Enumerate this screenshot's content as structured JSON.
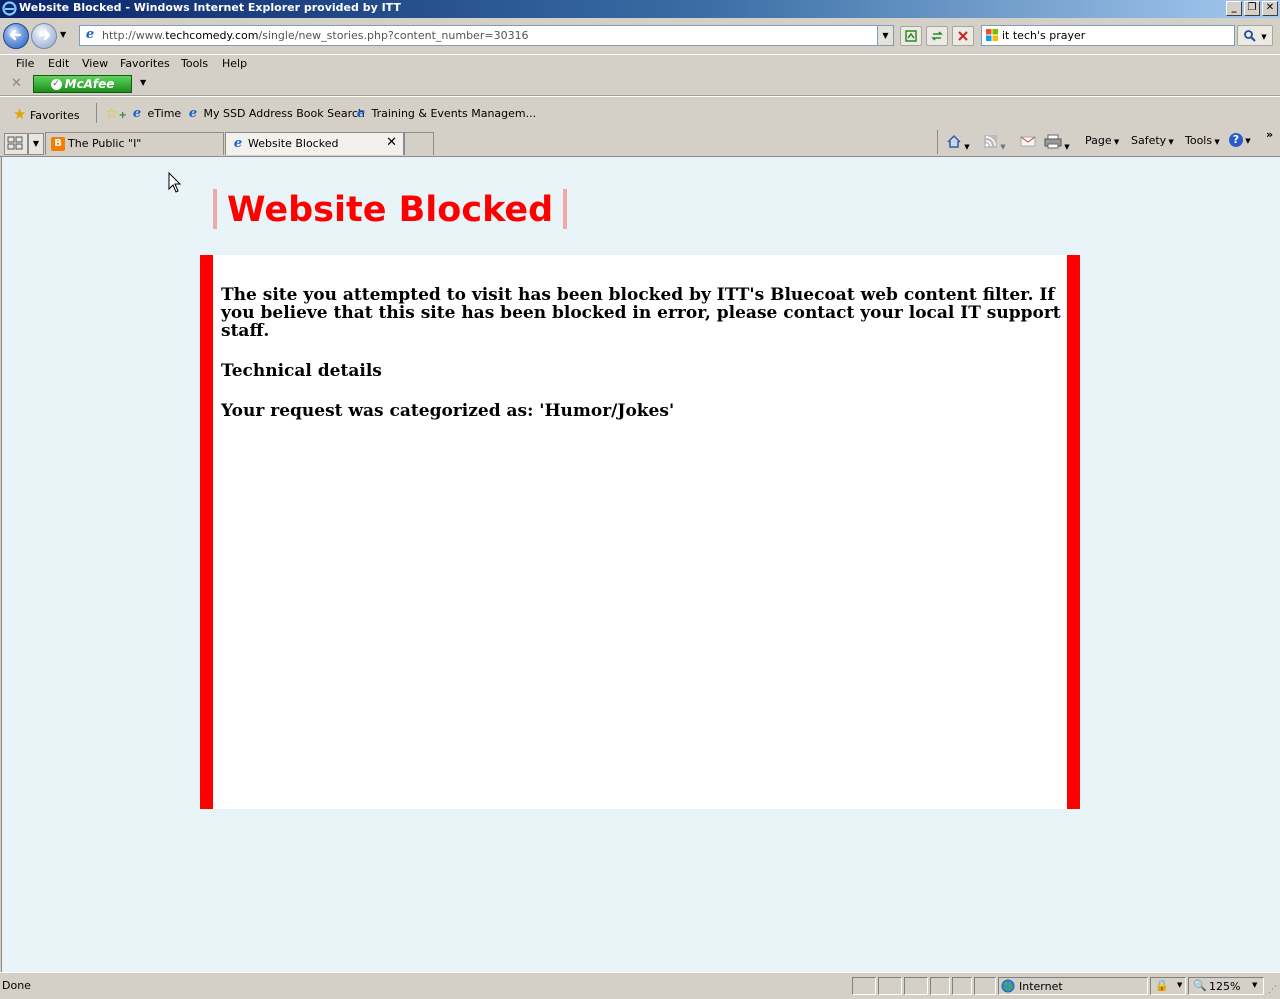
{
  "window": {
    "title": "Website Blocked - Windows Internet Explorer provided by ITT",
    "minimize_glyph": "_",
    "restore_glyph": "❐",
    "close_glyph": "✕"
  },
  "address": {
    "url_prefix": "http://www.",
    "url_domain": "techcomedy.com",
    "url_path": "/single/new_stories.php?content_number=30316"
  },
  "search": {
    "value": "it tech's prayer"
  },
  "menu": [
    "File",
    "Edit",
    "View",
    "Favorites",
    "Tools",
    "Help"
  ],
  "mcafee": {
    "label": "McAfee"
  },
  "favorites": {
    "label": "Favorites",
    "links": [
      "eTime",
      "My SSD Address Book Search",
      "Training & Events Managem..."
    ]
  },
  "tabs": [
    {
      "label": "The Public \"I\""
    },
    {
      "label": "Website Blocked"
    }
  ],
  "command_bar": {
    "page": "Page",
    "safety": "Safety",
    "tools": "Tools"
  },
  "page": {
    "heading": "Website Blocked",
    "message_line1": "The site you attempted to visit has been blocked by ITT's Bluecoat web content filter. If",
    "message_line2": "you believe that this site has been blocked in error, please contact your local IT support",
    "message_line3": "staff.",
    "technical_details": "Technical details",
    "category": "Your request was categorized as: 'Humor/Jokes'"
  },
  "status": {
    "text": "Done",
    "zone": "Internet",
    "zoom": "125%"
  },
  "colors": {
    "heading": "#ff0000",
    "panel_border": "#ff0000",
    "content_bg": "#e9f4f8"
  }
}
